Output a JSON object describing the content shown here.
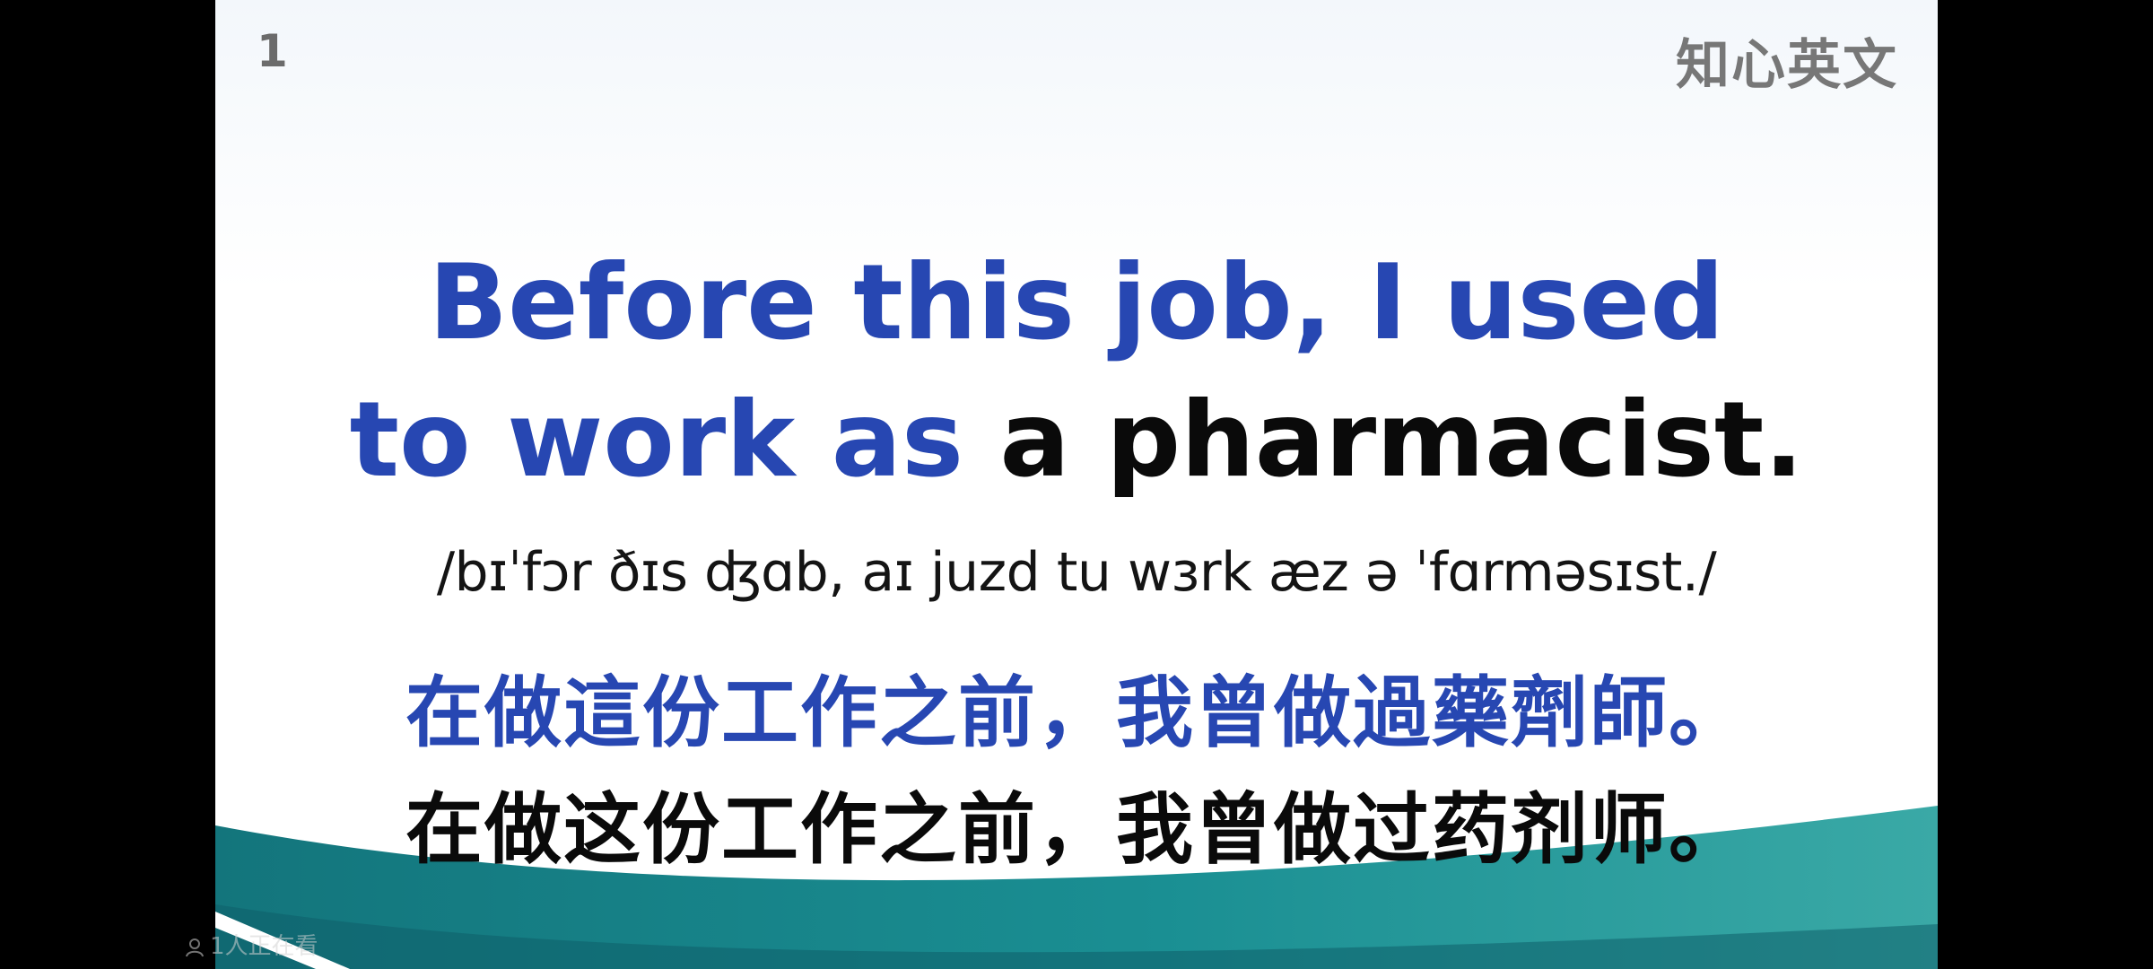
{
  "slide": {
    "number": "1",
    "brand": "知心英文",
    "sentence": {
      "line1": "Before this job, I used",
      "line2_blue": "to work as",
      "line2_black": "a pharmacist."
    },
    "ipa": "/bɪˈfɔr ðɪs ʤɑb, aɪ juzd tu wɜrk æz ə ˈfɑrməsɪst./",
    "chinese_traditional": "在做這份工作之前，我曾做過藥劑師。",
    "chinese_simplified": "在做这份工作之前，我曾做过药剂师。"
  },
  "overlay": {
    "viewer_count": "1人正在看",
    "viewer_icon": "person-icon"
  },
  "colors": {
    "highlight_blue": "#2747b2",
    "text_black": "#0a0a0a",
    "teal_wave": "#1a8a8f"
  }
}
